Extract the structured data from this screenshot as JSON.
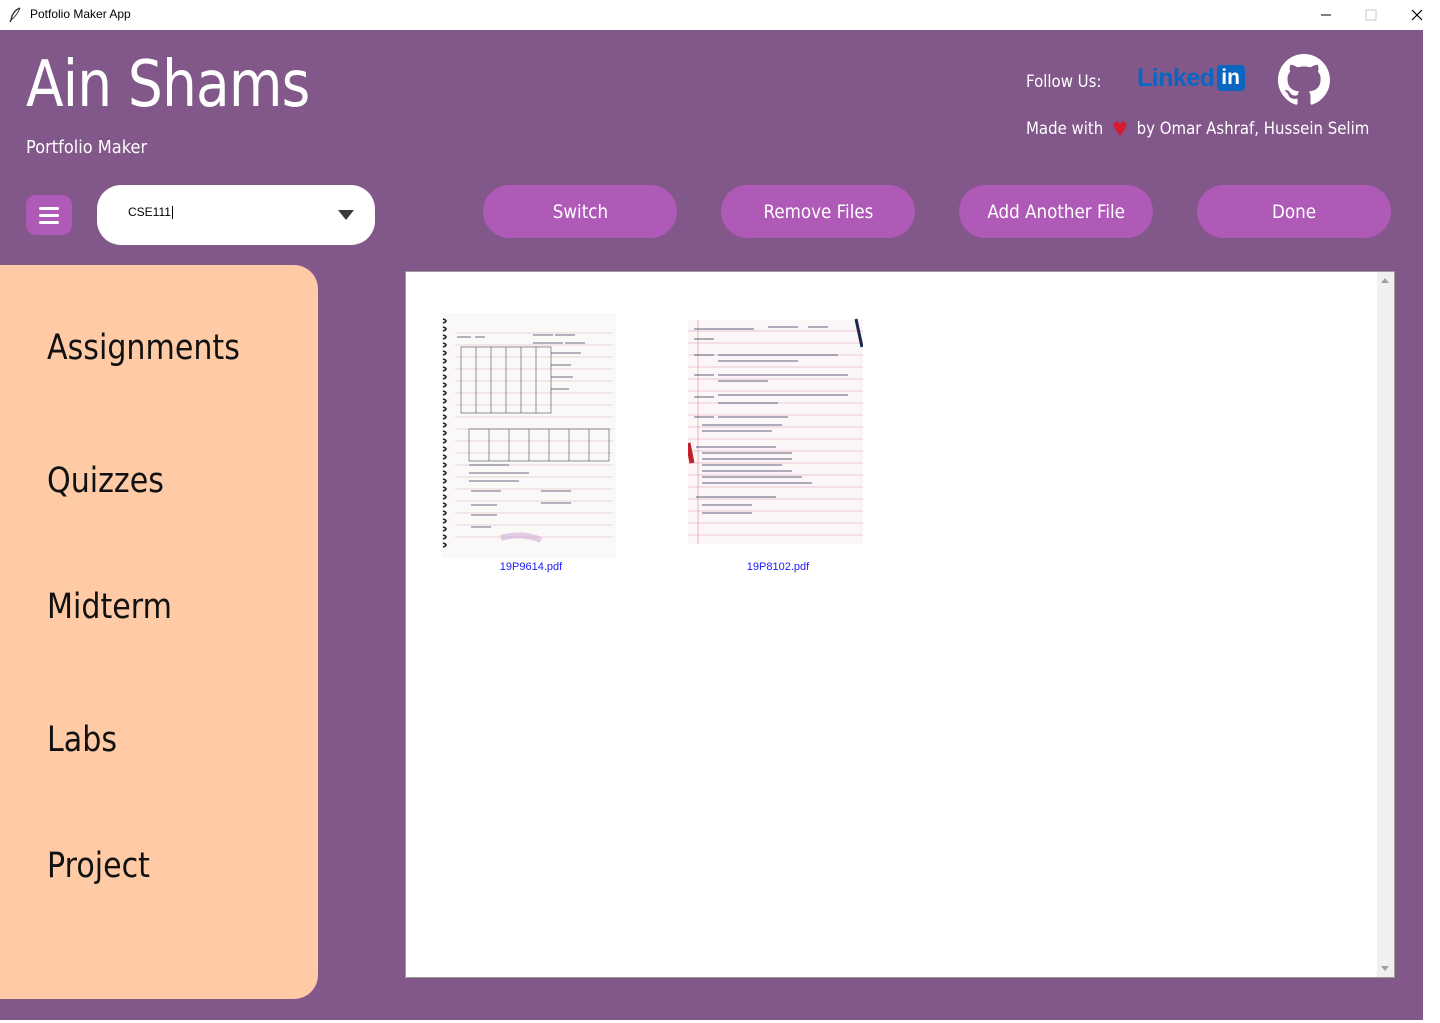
{
  "window": {
    "title": "Potfolio Maker App"
  },
  "header": {
    "brand_title": "Ain Shams",
    "brand_subtitle": "Portfolio Maker",
    "follow_label": "Follow Us:",
    "linkedin_text": "Linked",
    "linkedin_in": "in",
    "made_with_prefix": "Made with",
    "made_with_suffix": "by Omar Ashraf, Hussein Selim",
    "heart_glyph": "♥"
  },
  "toolbar": {
    "course_value": "CSE111",
    "switch_label": "Switch",
    "remove_label": "Remove Files",
    "add_label": "Add Another File",
    "done_label": "Done"
  },
  "sidebar": {
    "items": [
      {
        "label": "Assignments"
      },
      {
        "label": "Quizzes"
      },
      {
        "label": "Midterm"
      },
      {
        "label": "Labs"
      },
      {
        "label": "Project"
      }
    ]
  },
  "files": [
    {
      "name": "19P9614.pdf"
    },
    {
      "name": "19P8102.pdf"
    }
  ],
  "colors": {
    "background": "#825789",
    "button": "#b05ab8",
    "sidebar": "#fecba6",
    "linkedin": "#0b66c2",
    "file_link": "#1a1aff"
  }
}
